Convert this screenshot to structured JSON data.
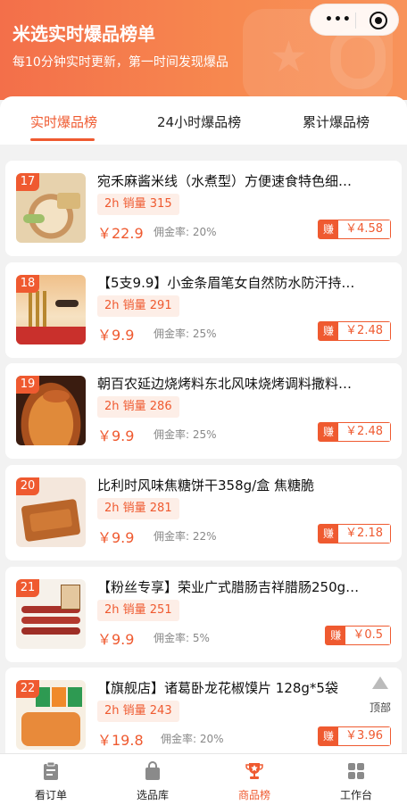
{
  "header": {
    "title": "米选实时爆品榜单",
    "subtitle": "每10分钟实时更新，第一时间发现爆品"
  },
  "capsule": {
    "more_icon": "more-dots-icon",
    "close_icon": "target-icon",
    "more_label": "•••"
  },
  "tabs": [
    {
      "label": "实时爆品榜",
      "active": true
    },
    {
      "label": "24小时爆品榜",
      "active": false
    },
    {
      "label": "累计爆品榜",
      "active": false
    }
  ],
  "accent_color": "#ef5a30",
  "products": [
    {
      "rank": "17",
      "name": "宛禾麻酱米线（水煮型）方便速食特色细…",
      "sales": "2h 销量 315",
      "price": "￥22.9",
      "commission": "佣金率: 20%",
      "earn_label": "赚",
      "earn_value": "￥4.58"
    },
    {
      "rank": "18",
      "name": "【5支9.9】小金条眉笔女自然防水防汗持…",
      "sales": "2h 销量 291",
      "price": "￥9.9",
      "commission": "佣金率: 25%",
      "earn_label": "赚",
      "earn_value": "￥2.48"
    },
    {
      "rank": "19",
      "name": "朝百农延边烧烤料东北风味烧烤调料撒料…",
      "sales": "2h 销量 286",
      "price": "￥9.9",
      "commission": "佣金率: 25%",
      "earn_label": "赚",
      "earn_value": "￥2.48"
    },
    {
      "rank": "20",
      "name": "比利时风味焦糖饼干358g/盒 焦糖脆",
      "sales": "2h 销量 281",
      "price": "￥9.9",
      "commission": "佣金率: 22%",
      "earn_label": "赚",
      "earn_value": "￥2.18"
    },
    {
      "rank": "21",
      "name": "【粉丝专享】荣业广式腊肠吉祥腊肠250g…",
      "sales": "2h 销量 251",
      "price": "￥9.9",
      "commission": "佣金率: 5%",
      "earn_label": "赚",
      "earn_value": "￥0.5"
    },
    {
      "rank": "22",
      "name": "【旗舰店】诸葛卧龙花椒馍片 128g*5袋",
      "sales": "2h 销量 243",
      "price": "￥19.8",
      "commission": "佣金率: 20%",
      "earn_label": "赚",
      "earn_value": "￥3.96"
    }
  ],
  "back_to_top": {
    "label": "顶部"
  },
  "bottom_nav": [
    {
      "label": "看订单",
      "icon": "clipboard-icon",
      "active": false
    },
    {
      "label": "选品库",
      "icon": "shopping-bag-icon",
      "active": false
    },
    {
      "label": "商品榜",
      "icon": "trophy-icon",
      "active": true
    },
    {
      "label": "工作台",
      "icon": "grid-icon",
      "active": false
    }
  ]
}
